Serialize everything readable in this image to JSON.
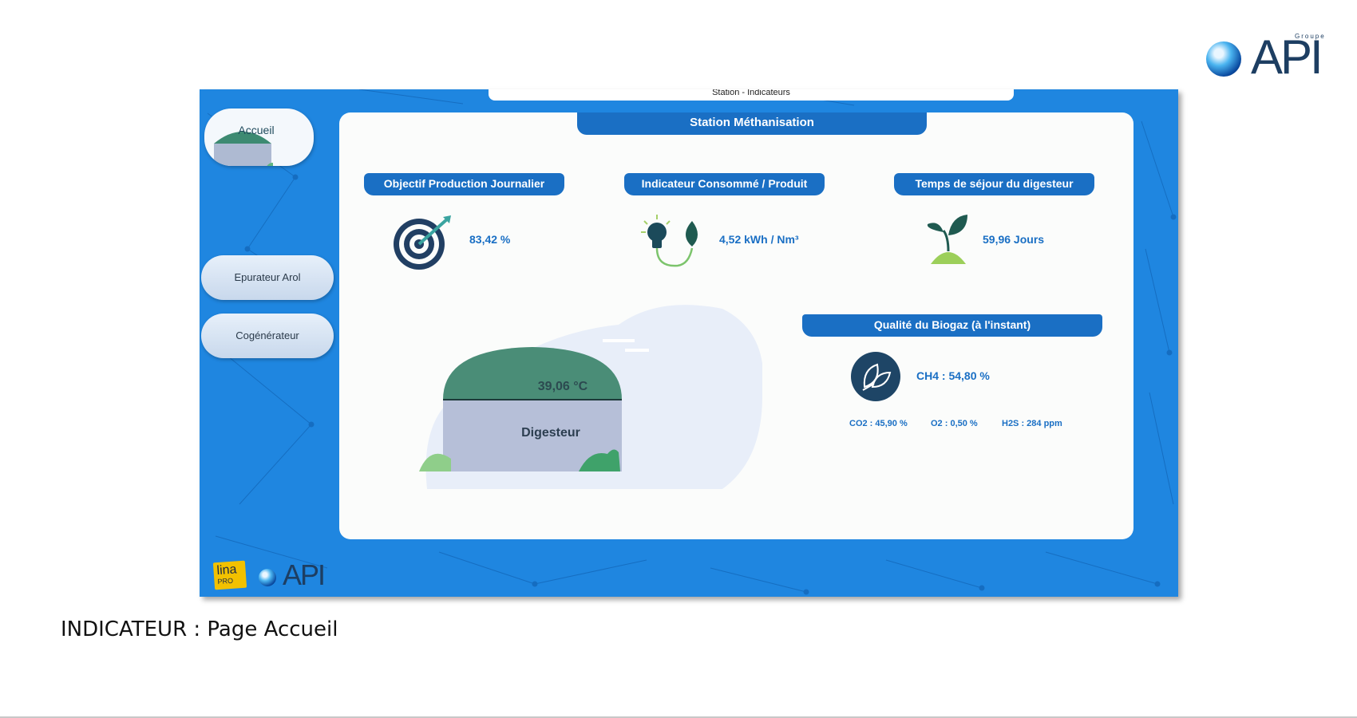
{
  "brand": {
    "top_label": "Groupe",
    "name": "API"
  },
  "window": {
    "title": "Station - Indicateurs"
  },
  "nav": {
    "home": "Accueil",
    "epurateur": "Epurateur Arol",
    "cogenerateur": "Cogénérateur"
  },
  "panel": {
    "title": "Station Méthanisation",
    "objectif": {
      "label": "Objectif Production Journalier",
      "value": "83,42 %",
      "icon": "target-icon"
    },
    "indicateur": {
      "label": "Indicateur Consommé / Produit",
      "value": "4,52 kWh / Nm³",
      "icon": "lightbulb-leaf-icon"
    },
    "sejour": {
      "label": "Temps de séjour du digesteur",
      "value": "59,96 Jours",
      "icon": "sprout-icon"
    },
    "qualite": {
      "label": "Qualité du Biogaz (à l'instant)",
      "ch4": "CH4 : 54,80 %",
      "co2": "CO2 : 45,90 %",
      "o2": "O2 : 0,50 %",
      "h2s": "H2S : 284 ppm",
      "icon": "leaf-icon"
    },
    "digesteur": {
      "temperature": "39,06 °C",
      "name": "Digesteur"
    }
  },
  "footer_logos": {
    "lina": "lina",
    "lina_sub": "PRO",
    "api": "API"
  },
  "caption": "INDICATEUR : Page Accueil",
  "colors": {
    "accent": "#1a6fc4",
    "background": "#1f86e0",
    "green": "#3d8a72"
  }
}
